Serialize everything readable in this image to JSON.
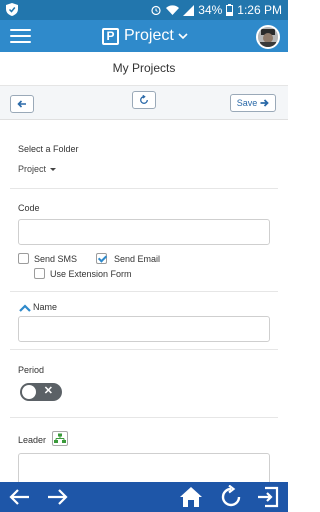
{
  "status": {
    "battery": "34%",
    "time": "1:26 PM"
  },
  "header": {
    "title": "Project"
  },
  "page": {
    "title": "My Projects"
  },
  "toolbar": {
    "save_label": "Save"
  },
  "form": {
    "folder": {
      "label": "Select a Folder",
      "value": "Project"
    },
    "code": {
      "label": "Code",
      "value": "",
      "placeholder": ""
    },
    "send_sms": {
      "label": "Send SMS",
      "checked": false
    },
    "send_email": {
      "label": "Send Email",
      "checked": true
    },
    "use_extension": {
      "label": "Use Extension Form",
      "checked": false
    },
    "name": {
      "label": "Name",
      "value": ""
    },
    "period": {
      "label": "Period",
      "enabled": false
    },
    "leader": {
      "label": "Leader",
      "value": ""
    }
  },
  "colors": {
    "primary": "#2f8acb",
    "statusbar": "#2276ad",
    "bottombar": "#1e56a8"
  }
}
